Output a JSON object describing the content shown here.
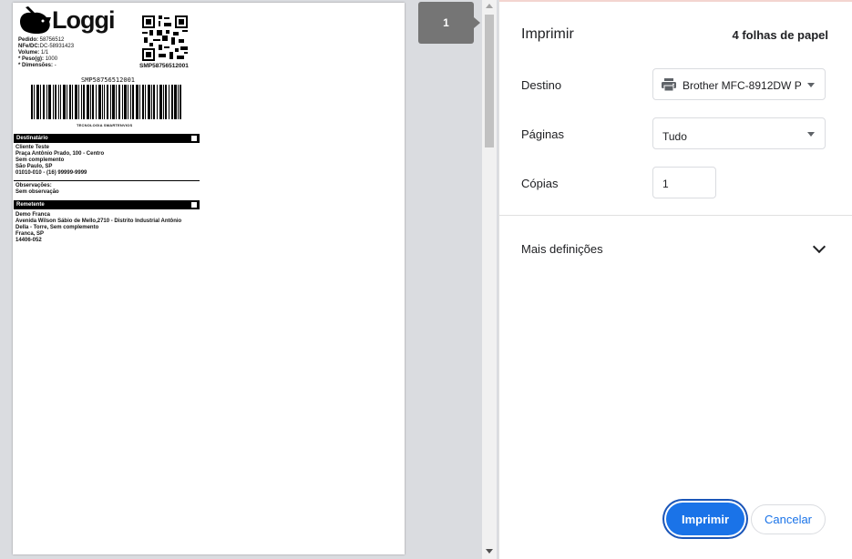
{
  "preview": {
    "page_badge": "1",
    "label": {
      "brand": "Loggi",
      "pedido_label": "Pedido:",
      "pedido_value": "58756512",
      "nfe_label": "NFe/DC:",
      "nfe_value": "DC-58931423",
      "volume_label": "Volume:",
      "volume_value": "1/1",
      "peso_label": "* Peso(g):",
      "peso_value": "1000",
      "dimensoes_label": "* Dimensões:",
      "dimensoes_value": "-",
      "qr_code_text": "SMP58756512001",
      "barcode_text": "SMP58756512001",
      "barcode_caption": "TECNOLOGIA SMARTENVIOS",
      "destinatario_title": "Destinatário",
      "dest_name": "Cliente Teste",
      "dest_address": "Praça Antônio Prado, 100 - Centro",
      "dest_complement": "Sem complemento",
      "dest_city": "São Paulo, SP",
      "dest_zip_phone": "01010-010 - (16) 99999-9999",
      "obs_label": "Observações:",
      "obs_value": "Sem observação",
      "remetente_title": "Remetente",
      "rem_name": "Demo Franca",
      "rem_address_1": "Avenida Wilson Sábio de Mello,2710 - Distrito Industrial Antônio",
      "rem_address_2": "Della - Torre, Sem complemento",
      "rem_city": "Franca, SP",
      "rem_zip": "14406-052"
    }
  },
  "panel": {
    "title": "Imprimir",
    "sheets": "4 folhas de papel",
    "destino_label": "Destino",
    "destino_value": "Brother MFC-8912DW P",
    "destino_icon": "printer-icon",
    "paginas_label": "Páginas",
    "paginas_value": "Tudo",
    "copias_label": "Cópias",
    "copias_value": "1",
    "more_settings": "Mais definições",
    "print_button": "Imprimir",
    "cancel_button": "Cancelar",
    "accent_color": "#1a73e8"
  }
}
